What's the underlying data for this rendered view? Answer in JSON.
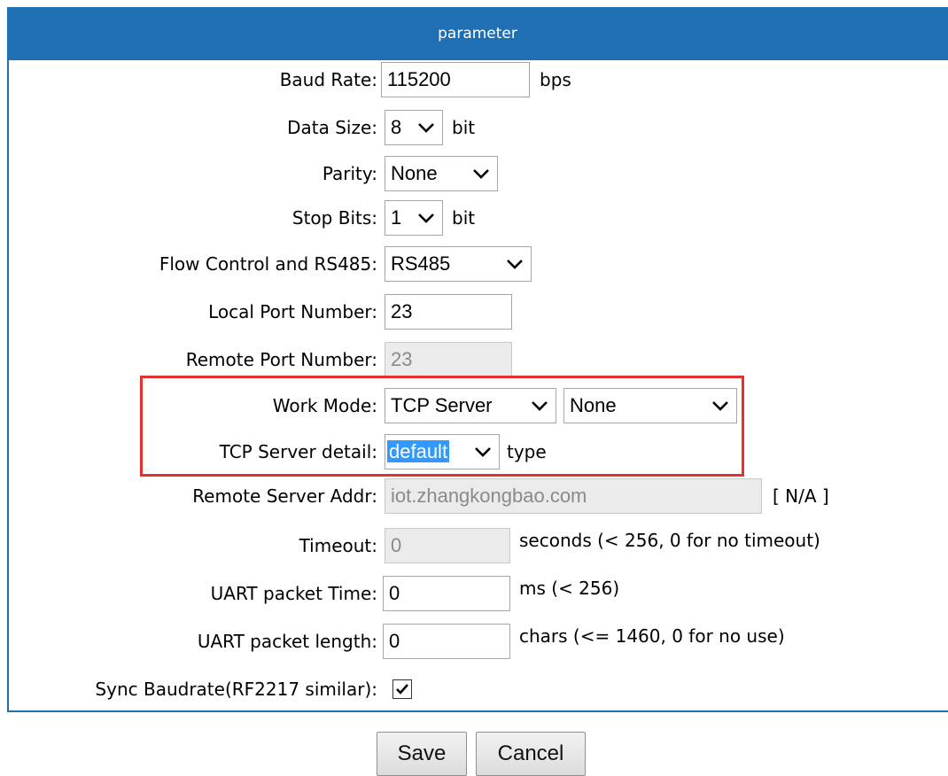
{
  "header": {
    "title": "parameter"
  },
  "fields": {
    "baud_rate": {
      "label": "Baud Rate:",
      "value": "115200",
      "unit": "bps"
    },
    "data_size": {
      "label": "Data Size:",
      "value": "8",
      "unit": "bit"
    },
    "parity": {
      "label": "Parity:",
      "value": "None"
    },
    "stop_bits": {
      "label": "Stop Bits:",
      "value": "1",
      "unit": "bit"
    },
    "flow_control": {
      "label": "Flow Control and RS485:",
      "value": "RS485"
    },
    "local_port": {
      "label": "Local Port Number:",
      "value": "23"
    },
    "remote_port": {
      "label": "Remote Port Number:",
      "value": "23"
    },
    "work_mode": {
      "label": "Work Mode:",
      "value": "TCP Server",
      "secondary_value": "None"
    },
    "tcp_server_detail": {
      "label": "TCP Server detail:",
      "value": "default",
      "unit": "type"
    },
    "remote_server_addr": {
      "label": "Remote Server Addr:",
      "value": "iot.zhangkongbao.com",
      "unit": "[ N/A ]"
    },
    "timeout": {
      "label": "Timeout:",
      "value": "0",
      "unit": "seconds (< 256, 0 for no timeout)"
    },
    "uart_packet_time": {
      "label": "UART packet Time:",
      "value": "0",
      "unit": "ms (< 256)"
    },
    "uart_packet_length": {
      "label": "UART packet length:",
      "value": "0",
      "unit": "chars (<= 1460, 0 for no use)"
    },
    "sync_baudrate": {
      "label": "Sync Baudrate(RF2217 similar):",
      "checked": true
    }
  },
  "buttons": {
    "save": "Save",
    "cancel": "Cancel"
  },
  "colors": {
    "header_bg": "#1f6fb5",
    "highlight_border": "#e4302f",
    "selection": "#3399ff"
  }
}
